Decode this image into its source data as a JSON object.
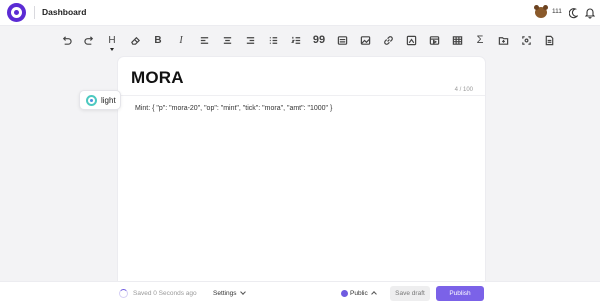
{
  "header": {
    "title": "Dashboard",
    "points": "111"
  },
  "toolbar": {
    "items": [
      {
        "name": "undo",
        "icon": "undo-icon"
      },
      {
        "name": "redo",
        "icon": "redo-icon"
      },
      {
        "name": "heading",
        "icon": "heading-icon",
        "label": "H"
      },
      {
        "name": "clear-format",
        "icon": "eraser-icon"
      },
      {
        "name": "bold",
        "icon": "bold-icon",
        "label": "B"
      },
      {
        "name": "italic",
        "icon": "italic-icon",
        "label": "I"
      },
      {
        "name": "align-left",
        "icon": "align-left-icon"
      },
      {
        "name": "align-center",
        "icon": "align-center-icon"
      },
      {
        "name": "align-right",
        "icon": "align-right-icon"
      },
      {
        "name": "bullet-list",
        "icon": "bullet-list-icon"
      },
      {
        "name": "ordered-list",
        "icon": "ordered-list-icon"
      },
      {
        "name": "quote",
        "icon": "quote-icon",
        "label": "99"
      },
      {
        "name": "code-block",
        "icon": "code-block-icon"
      },
      {
        "name": "image",
        "icon": "image-icon"
      },
      {
        "name": "link",
        "icon": "link-icon"
      },
      {
        "name": "embed",
        "icon": "embed-icon"
      },
      {
        "name": "video",
        "icon": "video-icon"
      },
      {
        "name": "table",
        "icon": "table-icon"
      },
      {
        "name": "formula",
        "icon": "sigma-icon",
        "label": "Σ"
      },
      {
        "name": "folder",
        "icon": "folder-icon"
      },
      {
        "name": "screenshot",
        "icon": "screenshot-icon"
      },
      {
        "name": "document",
        "icon": "document-icon"
      }
    ]
  },
  "editor": {
    "title": "MORA",
    "counter": "4 / 100",
    "body": "Mint: { \"p\": \"mora-20\", \"op\": \"mint\", \"tick\": \"mora\", \"amt\": \"1000\" }"
  },
  "chip": {
    "label": "light",
    "icon": "theme-icon"
  },
  "footer": {
    "status": "Saved 0 Seconds ago",
    "settings_label": "Settings",
    "visibility_label": "Public",
    "save_draft_label": "Save draft",
    "publish_label": "Publish"
  },
  "colors": {
    "accent": "#7b62e8",
    "brand": "#5b2bd4"
  }
}
